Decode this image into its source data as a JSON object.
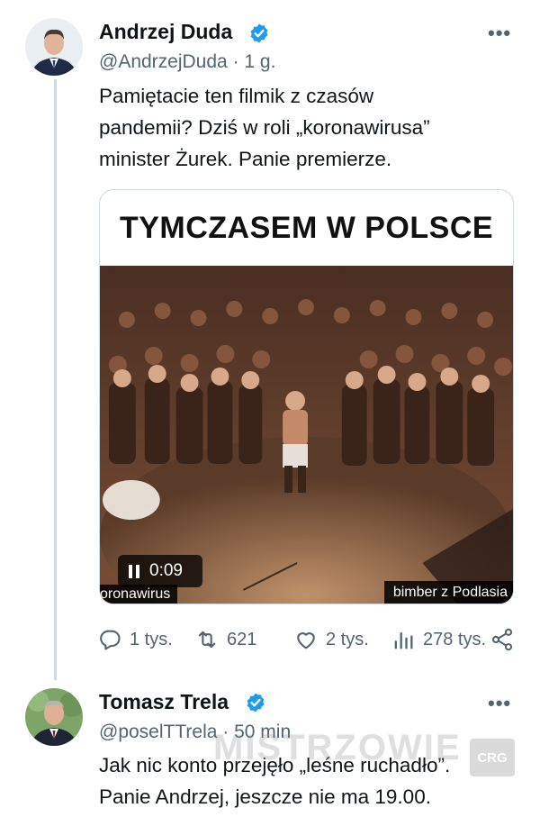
{
  "tweet1": {
    "author_name": "Andrzej Duda",
    "handle": "@AndrzejDuda",
    "time": "1 g.",
    "text_lines": [
      "Pamiętacie ten filmik z czasów",
      "pandemii?  Dziś w roli „koronawirusa”",
      "minister Żurek. Panie premierze."
    ],
    "media": {
      "title": "TYMCZASEM W POLSCE",
      "duration": "0:09",
      "caption_left": "oronawirus",
      "caption_right": "bimber z Podlasia"
    },
    "actions": {
      "replies": "1 tys.",
      "reposts": "621",
      "likes": "2 tys.",
      "views": "278 tys."
    },
    "icons": [
      "verified-badge-icon",
      "more-options-icon",
      "reply-icon",
      "repost-icon",
      "like-icon",
      "views-icon",
      "share-icon"
    ]
  },
  "tweet2": {
    "author_name": "Tomasz Trela",
    "handle": "@poselTTrela",
    "time": "50 min",
    "text_lines": [
      "Jak nic konto przejęło „leśne ruchadło”.",
      "Panie Andrzej, jeszcze nie ma 19.00."
    ]
  },
  "watermark": {
    "text": "MISTRZOWIE",
    "badge": "CRG"
  },
  "colors": {
    "verified": "#1d9bf0",
    "secondary_text": "#536471",
    "thread_line": "#cfd9de"
  }
}
